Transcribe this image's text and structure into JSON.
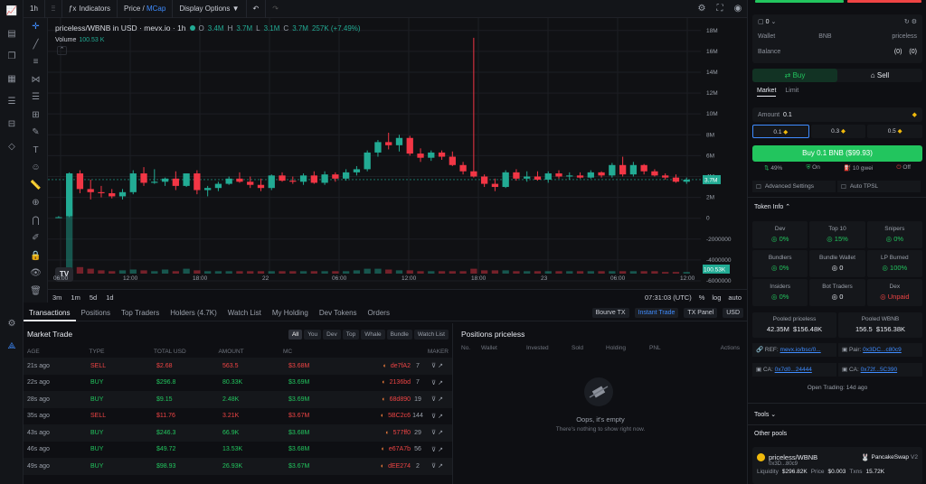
{
  "topbar": {
    "interval": "1h",
    "candle_icon": "candles-icon",
    "indicators": "Indicators",
    "price": "Price",
    "slash": "/",
    "mcap": "MCap",
    "display_options": "Display Options"
  },
  "legend": {
    "title": "priceless/WBNB in USD · mevx.io · 1h",
    "o_key": "O",
    "o": "3.4M",
    "h_key": "H",
    "h": "3.7M",
    "l_key": "L",
    "l": "3.1M",
    "c_key": "C",
    "c": "3.7M",
    "change": "257K (+7.49%)",
    "volume_label": "Volume",
    "volume_value": "100.53 K"
  },
  "chart_data": {
    "type": "candlestick",
    "y_ticks": [
      "18M",
      "16M",
      "14M",
      "12M",
      "10M",
      "8M",
      "6M",
      "4M",
      "2M",
      "0",
      "-2000000",
      "-4000000",
      "-6000000"
    ],
    "x_ticks": [
      "06:00",
      "12:00",
      "18:00",
      "22",
      "06:00",
      "12:00",
      "18:00",
      "23",
      "06:00",
      "12:00"
    ],
    "ylim": [
      -6000000,
      18500000
    ],
    "last_price_tag": "3.7M",
    "volume_tag": "100.53K",
    "candles": [
      {
        "o": 0.1,
        "h": 0.2,
        "l": 0.05,
        "c": 0.1,
        "v": 0.2
      },
      {
        "o": 0.2,
        "h": 4.4,
        "l": 0.1,
        "c": 4.3,
        "v": 8
      },
      {
        "o": 4.3,
        "h": 4.6,
        "l": 2.4,
        "c": 2.8,
        "v": 0.8
      },
      {
        "o": 2.8,
        "h": 3.7,
        "l": 1.8,
        "c": 2.5,
        "v": 0.6
      },
      {
        "o": 2.5,
        "h": 3.1,
        "l": 2.0,
        "c": 2.4,
        "v": 0.4
      },
      {
        "o": 2.4,
        "h": 2.8,
        "l": 1.9,
        "c": 2.1,
        "v": 0.3
      },
      {
        "o": 2.1,
        "h": 2.8,
        "l": 1.8,
        "c": 2.5,
        "v": 0.4
      },
      {
        "o": 2.5,
        "h": 4.6,
        "l": 2.3,
        "c": 4.3,
        "v": 0.5
      },
      {
        "o": 4.3,
        "h": 4.9,
        "l": 3.1,
        "c": 3.4,
        "v": 0.4
      },
      {
        "o": 3.4,
        "h": 4.7,
        "l": 3.3,
        "c": 3.5,
        "v": 0.3
      },
      {
        "o": 3.5,
        "h": 3.9,
        "l": 3.1,
        "c": 3.8,
        "v": 0.5
      },
      {
        "o": 3.8,
        "h": 4.5,
        "l": 2.7,
        "c": 3.1,
        "v": 0.3
      },
      {
        "o": 3.1,
        "h": 4.3,
        "l": 3.0,
        "c": 4.3,
        "v": 0.6
      },
      {
        "o": 4.3,
        "h": 4.6,
        "l": 2.3,
        "c": 2.7,
        "v": 0.4
      },
      {
        "o": 2.7,
        "h": 3.1,
        "l": 2.1,
        "c": 2.9,
        "v": 0.3
      },
      {
        "o": 2.9,
        "h": 3.5,
        "l": 2.6,
        "c": 3.3,
        "v": 0.3
      },
      {
        "o": 3.3,
        "h": 4.0,
        "l": 3.2,
        "c": 3.8,
        "v": 0.3
      },
      {
        "o": 3.8,
        "h": 4.4,
        "l": 3.4,
        "c": 3.5,
        "v": 0.3
      },
      {
        "o": 3.5,
        "h": 4.0,
        "l": 2.9,
        "c": 3.2,
        "v": 0.3
      },
      {
        "o": 3.2,
        "h": 3.8,
        "l": 2.6,
        "c": 2.9,
        "v": 0.3
      },
      {
        "o": 2.9,
        "h": 4.2,
        "l": 2.7,
        "c": 4.1,
        "v": 0.3
      },
      {
        "o": 4.1,
        "h": 4.4,
        "l": 3.5,
        "c": 3.6,
        "v": 0.3
      },
      {
        "o": 3.6,
        "h": 4.0,
        "l": 3.3,
        "c": 3.5,
        "v": 0.3
      },
      {
        "o": 3.5,
        "h": 4.3,
        "l": 3.2,
        "c": 4.1,
        "v": 0.3
      },
      {
        "o": 4.1,
        "h": 4.5,
        "l": 3.3,
        "c": 3.4,
        "v": 0.3
      },
      {
        "o": 3.4,
        "h": 4.5,
        "l": 3.2,
        "c": 4.2,
        "v": 0.3
      },
      {
        "o": 4.2,
        "h": 4.4,
        "l": 3.5,
        "c": 3.8,
        "v": 0.3
      },
      {
        "o": 3.8,
        "h": 4.7,
        "l": 3.6,
        "c": 4.4,
        "v": 0.3
      },
      {
        "o": 4.4,
        "h": 5.0,
        "l": 4.1,
        "c": 4.7,
        "v": 0.4
      },
      {
        "o": 4.7,
        "h": 6.5,
        "l": 4.5,
        "c": 6.3,
        "v": 0.6
      },
      {
        "o": 6.3,
        "h": 7.5,
        "l": 5.9,
        "c": 7.3,
        "v": 0.6
      },
      {
        "o": 7.3,
        "h": 8.2,
        "l": 6.6,
        "c": 7.0,
        "v": 0.5
      },
      {
        "o": 7.0,
        "h": 8.0,
        "l": 6.4,
        "c": 7.7,
        "v": 0.4
      },
      {
        "o": 7.7,
        "h": 7.9,
        "l": 6.0,
        "c": 6.2,
        "v": 0.4
      },
      {
        "o": 6.2,
        "h": 6.7,
        "l": 5.4,
        "c": 5.8,
        "v": 0.3
      },
      {
        "o": 5.8,
        "h": 6.5,
        "l": 5.5,
        "c": 6.3,
        "v": 0.3
      },
      {
        "o": 6.3,
        "h": 6.5,
        "l": 5.6,
        "c": 5.9,
        "v": 0.3
      },
      {
        "o": 5.9,
        "h": 6.4,
        "l": 5.0,
        "c": 5.1,
        "v": 0.3
      },
      {
        "o": 5.1,
        "h": 5.4,
        "l": 4.2,
        "c": 4.5,
        "v": 0.3
      },
      {
        "o": 4.5,
        "h": 17.3,
        "l": 3.9,
        "c": 4.0,
        "v": 0.6
      },
      {
        "o": 4.0,
        "h": 4.2,
        "l": 3.0,
        "c": 3.3,
        "v": 0.4
      },
      {
        "o": 3.3,
        "h": 3.8,
        "l": 2.6,
        "c": 3.0,
        "v": 0.4
      },
      {
        "o": 3.0,
        "h": 4.6,
        "l": 2.9,
        "c": 4.4,
        "v": 0.4
      },
      {
        "o": 4.4,
        "h": 4.7,
        "l": 3.6,
        "c": 3.8,
        "v": 0.3
      },
      {
        "o": 3.8,
        "h": 4.5,
        "l": 3.5,
        "c": 4.0,
        "v": 0.3
      },
      {
        "o": 4.0,
        "h": 4.5,
        "l": 3.6,
        "c": 3.7,
        "v": 0.3
      },
      {
        "o": 3.7,
        "h": 4.5,
        "l": 3.4,
        "c": 4.3,
        "v": 0.3
      },
      {
        "o": 4.3,
        "h": 4.6,
        "l": 3.8,
        "c": 4.0,
        "v": 0.3
      },
      {
        "o": 4.0,
        "h": 4.4,
        "l": 3.7,
        "c": 4.1,
        "v": 0.3
      },
      {
        "o": 4.1,
        "h": 4.4,
        "l": 3.8,
        "c": 3.9,
        "v": 0.3
      },
      {
        "o": 3.9,
        "h": 4.6,
        "l": 3.8,
        "c": 4.4,
        "v": 0.3
      },
      {
        "o": 4.4,
        "h": 4.5,
        "l": 3.9,
        "c": 4.1,
        "v": 0.3
      },
      {
        "o": 4.1,
        "h": 5.3,
        "l": 3.9,
        "c": 5.1,
        "v": 0.3
      },
      {
        "o": 5.1,
        "h": 5.9,
        "l": 4.0,
        "c": 4.2,
        "v": 0.3
      },
      {
        "o": 4.2,
        "h": 5.4,
        "l": 4.0,
        "c": 5.1,
        "v": 0.3
      },
      {
        "o": 5.1,
        "h": 5.2,
        "l": 4.2,
        "c": 4.5,
        "v": 0.3
      },
      {
        "o": 4.5,
        "h": 4.7,
        "l": 4.0,
        "c": 4.1,
        "v": 0.3
      },
      {
        "o": 4.1,
        "h": 4.3,
        "l": 3.7,
        "c": 3.9,
        "v": 0.2
      },
      {
        "o": 3.9,
        "h": 4.2,
        "l": 3.4,
        "c": 3.5,
        "v": 0.2
      },
      {
        "o": 3.5,
        "h": 3.9,
        "l": 3.3,
        "c": 3.7,
        "v": 0.2
      }
    ]
  },
  "chart_footer": {
    "ranges": [
      "3m",
      "1m",
      "5d",
      "1d"
    ],
    "time": "07:31:03 (UTC)",
    "pct": "%",
    "log": "log",
    "auto": "auto"
  },
  "tx_tabs": [
    "Transactions",
    "Positions",
    "Top Traders",
    "Holders (4.7K)",
    "Watch List",
    "My Holding",
    "Dev Tokens",
    "Orders"
  ],
  "tx_right": {
    "bourse": "Bourve TX",
    "instant": "Instant Trade",
    "tx_panel": "TX Panel",
    "usd": "USD"
  },
  "market": {
    "title": "Market Trade",
    "filters": [
      "All",
      "You",
      "Dev",
      "Top",
      "Whale",
      "Bundle",
      "Watch List"
    ],
    "columns": [
      "AGE",
      "TYPE",
      "TOTAL USD",
      "AMOUNT",
      "MC",
      "MAKER"
    ],
    "rows": [
      {
        "age": "21s ago",
        "type": "SELL",
        "total": "$2.68",
        "amount": "563.5",
        "mc": "$3.68M",
        "maker": "de7fA2",
        "n": "7"
      },
      {
        "age": "22s ago",
        "type": "BUY",
        "total": "$296.8",
        "amount": "80.33K",
        "mc": "$3.69M",
        "maker": "2136bd",
        "n": "7"
      },
      {
        "age": "28s ago",
        "type": "BUY",
        "total": "$9.15",
        "amount": "2.48K",
        "mc": "$3.69M",
        "maker": "68d890",
        "n": "19"
      },
      {
        "age": "35s ago",
        "type": "SELL",
        "total": "$11.76",
        "amount": "3.21K",
        "mc": "$3.67M",
        "maker": "5BC2c6",
        "n": "144"
      },
      {
        "age": "43s ago",
        "type": "BUY",
        "total": "$246.3",
        "amount": "66.9K",
        "mc": "$3.68M",
        "maker": "577ff0",
        "n": "29"
      },
      {
        "age": "46s ago",
        "type": "BUY",
        "total": "$49.72",
        "amount": "13.53K",
        "mc": "$3.68M",
        "maker": "e67A7b",
        "n": "56"
      },
      {
        "age": "49s ago",
        "type": "BUY",
        "total": "$98.93",
        "amount": "26.93K",
        "mc": "$3.67M",
        "maker": "dEE274",
        "n": "2"
      }
    ]
  },
  "positions": {
    "title": "Positions priceless",
    "columns": [
      "No.",
      "Wallet",
      "Invested",
      "Sold",
      "Holding",
      "PNL",
      "Actions"
    ],
    "empty_title": "Oops, it's empty",
    "empty_sub": "There's nothing to show right now."
  },
  "right": {
    "wallet_count": "0",
    "wallet_label": "Wallet",
    "bnb_label": "BNB",
    "priceless_label": "priceless",
    "balance_label": "Balance",
    "balance_bnb": "0",
    "balance_priceless": "0",
    "buy_tab": "Buy",
    "sell_tab": "Sell",
    "market_tab": "Market",
    "limit_tab": "Limit",
    "amount_label": "Amount",
    "amount_value": "0.1",
    "presets": [
      "0.1",
      "0.3",
      "0.5"
    ],
    "buy_button": "Buy 0.1 BNB ($99.93)",
    "slippage": "49%",
    "mev": "On",
    "gas": "10 gwei",
    "auto": "Off",
    "advanced": "Advanced Settings",
    "auto_tpsl": "Auto TPSL",
    "token_info": "Token Info",
    "stats": [
      {
        "l": "Dev",
        "v": "0%",
        "c": "g"
      },
      {
        "l": "Top 10",
        "v": "15%",
        "c": "g"
      },
      {
        "l": "Snipers",
        "v": "0%",
        "c": "g"
      },
      {
        "l": "Bundlers",
        "v": "0%",
        "c": "g"
      },
      {
        "l": "Bundle Wallet",
        "v": "0",
        "c": "w"
      },
      {
        "l": "LP Burned",
        "v": "100%",
        "c": "g"
      },
      {
        "l": "Insiders",
        "v": "0%",
        "c": "g"
      },
      {
        "l": "Bot Traders",
        "v": "0",
        "c": "w"
      },
      {
        "l": "Dex",
        "v": "Unpaid",
        "c": "r"
      }
    ],
    "pooled_priceless_label": "Pooled priceless",
    "pooled_priceless": "42.35M",
    "pooled_priceless_usd": "$156.48K",
    "pooled_wbnb_label": "Pooled WBNB",
    "pooled_wbnb": "156.5",
    "pooled_wbnb_usd": "$156.38K",
    "ref_label": "REF:",
    "ref": "mevx.io/bsc/0...",
    "pair_label": "Pair:",
    "pair": "0x3DC...c80c9",
    "ca_label": "CA:",
    "ca": "0x7d0...24444",
    "ca2_label": "CA:",
    "ca2": "0x72f...5C390",
    "open_trading": "Open Trading: 14d ago",
    "tools": "Tools",
    "other_pools": "Other pools",
    "pool_name": "priceless/WBNB",
    "pool_dex": "PancakeSwap",
    "pool_ver": "V2",
    "pool_addr": "0x3D...80c9",
    "liq_label": "Liquidity",
    "liq": "$296.82K",
    "price_label": "Price",
    "price": "$0.003",
    "txns_label": "Txns",
    "txns": "15.72K"
  },
  "colors": {
    "up": "#22ab94",
    "down": "#f23645",
    "buy": "#22c55e",
    "sell": "#ef4444",
    "accent": "#3f8cff"
  }
}
